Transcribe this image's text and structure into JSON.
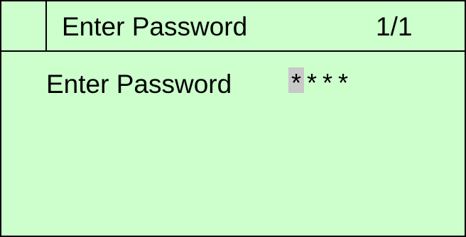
{
  "header": {
    "title": "Enter Password",
    "page_indicator": "1/1"
  },
  "password_row": {
    "label": "Enter Password",
    "chars": [
      "*",
      "*",
      "*",
      "*"
    ],
    "cursor_index": 0
  },
  "colors": {
    "screen_background": "#ccffcc",
    "cursor_highlight": "#c8c8c8",
    "text": "#000000"
  }
}
